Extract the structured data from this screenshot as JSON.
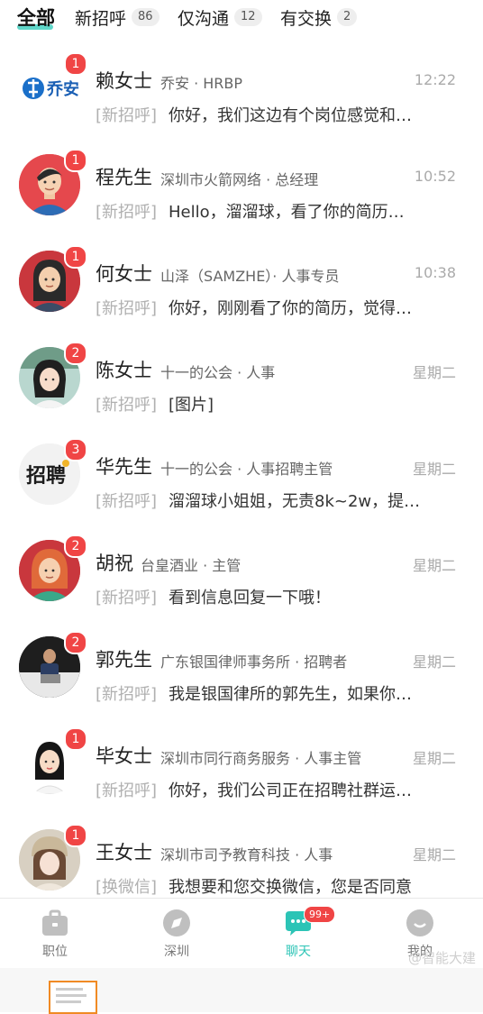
{
  "tabs": [
    {
      "label": "全部",
      "count": ""
    },
    {
      "label": "新招呼",
      "count": "86"
    },
    {
      "label": "仅沟通",
      "count": "12"
    },
    {
      "label": "有交换",
      "count": "2"
    }
  ],
  "chats": [
    {
      "badge": "1",
      "name": "赖女士",
      "company": "乔安 · HRBP",
      "time": "12:22",
      "tag": "[新招呼]",
      "message": "你好，我们这边有个岗位感觉和…",
      "avatar": "qiaoan-logo",
      "logo_text": "乔安"
    },
    {
      "badge": "1",
      "name": "程先生",
      "company": "深圳市火箭网络 · 总经理",
      "time": "10:52",
      "tag": "[新招呼]",
      "message": "Hello，溜溜球，看了你的简历…",
      "avatar": "male-avatar"
    },
    {
      "badge": "1",
      "name": "何女士",
      "company": "山泽（SAMZHE）· 人事专员",
      "time": "10:38",
      "tag": "[新招呼]",
      "message": "你好，刚刚看了你的简历，觉得…",
      "avatar": "female-avatar"
    },
    {
      "badge": "2",
      "name": "陈女士",
      "company": "十一的公会 · 人事",
      "time": "星期二",
      "tag": "[新招呼]",
      "message": "[图片]",
      "avatar": "photo-girl"
    },
    {
      "badge": "3",
      "name": "华先生",
      "company": "十一的公会 · 人事招聘主管",
      "time": "星期二",
      "tag": "[新招呼]",
      "message": "溜溜球小姐姐，无责8k~2w，提…",
      "avatar": "zhaopin-logo",
      "logo_text": "招聘"
    },
    {
      "badge": "2",
      "name": "胡祝",
      "company": "台皇酒业 · 主管",
      "time": "星期二",
      "tag": "[新招呼]",
      "message": "看到信息回复一下哦！",
      "avatar": "redhair-avatar"
    },
    {
      "badge": "2",
      "name": "郭先生",
      "company": "广东银国律师事务所 · 招聘者",
      "time": "星期二",
      "tag": "[新招呼]",
      "message": "我是银国律所的郭先生，如果你…",
      "avatar": "photo-man"
    },
    {
      "badge": "1",
      "name": "毕女士",
      "company": "深圳市同行商务服务 · 人事主管",
      "time": "星期二",
      "tag": "[新招呼]",
      "message": "你好，我们公司正在招聘社群运…",
      "avatar": "cartoon-girl"
    },
    {
      "badge": "1",
      "name": "王女士",
      "company": "深圳市司予教育科技 · 人事",
      "time": "星期二",
      "tag": "[换微信]",
      "message": "我想要和您交换微信，您是否同意",
      "avatar": "photo-woman"
    }
  ],
  "nav": [
    {
      "label": "职位",
      "icon": "briefcase-icon"
    },
    {
      "label": "深圳",
      "icon": "compass-icon"
    },
    {
      "label": "聊天",
      "icon": "chat-icon",
      "badge": "99+"
    },
    {
      "label": "我的",
      "icon": "profile-icon"
    }
  ],
  "watermark": "@智能大建",
  "colors": {
    "accent": "#2cc4b6",
    "badge": "#f04545",
    "underline": "#5fd6c9"
  }
}
